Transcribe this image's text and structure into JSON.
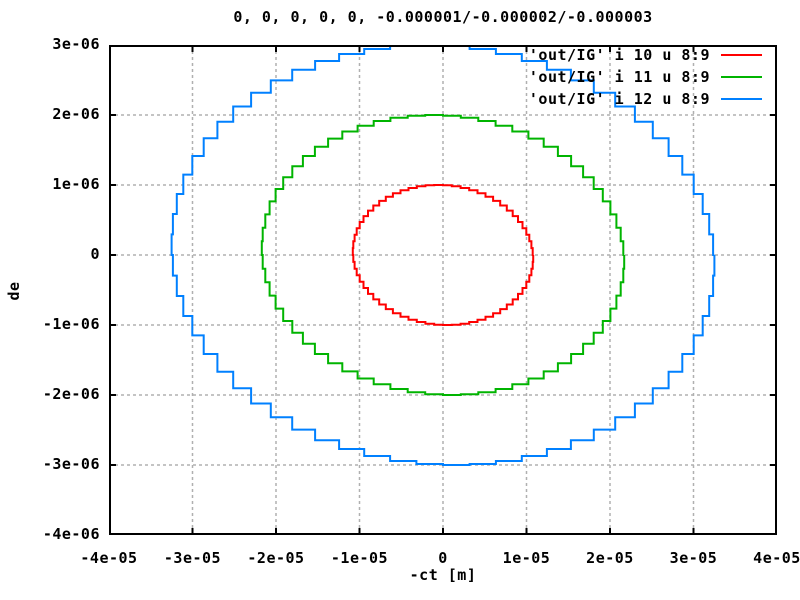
{
  "title": "0, 0, 0, 0, 0, -0.000001/-0.000002/-0.000003",
  "colors": {
    "background": "#ffffff",
    "border": "#000000",
    "grid": "#b0b0b0",
    "red": "#ff0000",
    "green": "#00b400",
    "blue": "#0080ff"
  },
  "chart_data": {
    "type": "line",
    "style": "steps",
    "title": "0, 0, 0, 0, 0, -0.000001/-0.000002/-0.000003",
    "xlabel": "-ct [m]",
    "ylabel": "de",
    "xlim": [
      -4e-05,
      4e-05
    ],
    "ylim": [
      -4e-06,
      3e-06
    ],
    "xticks": [
      -4e-05,
      -3e-05,
      -2e-05,
      -1e-05,
      0,
      1e-05,
      2e-05,
      3e-05,
      4e-05
    ],
    "xtick_labels": [
      "-4e-05",
      "-3e-05",
      "-2e-05",
      "-1e-05",
      "0",
      "1e-05",
      "2e-05",
      "3e-05",
      "4e-05"
    ],
    "yticks": [
      -4e-06,
      -3e-06,
      -2e-06,
      -1e-06,
      0,
      1e-06,
      2e-06,
      3e-06
    ],
    "ytick_labels": [
      "-4e-06",
      "-3e-06",
      "-2e-06",
      "-1e-06",
      "0",
      "1e-06",
      "2e-06",
      "3e-06"
    ],
    "grid": true,
    "grid_dash": "3,3",
    "legend_position": "top-right-inside",
    "points_per_ellipse": 64,
    "series": [
      {
        "name": "'out/IG' i 10 u 8:9",
        "color": "#ff0000",
        "shape": "stepped-ellipse",
        "center_x": 0,
        "center_y": 0,
        "x_semi_axis": 1.08e-05,
        "y_semi_axis": 1e-06
      },
      {
        "name": "'out/IG' i 11 u 8:9",
        "color": "#00b400",
        "shape": "stepped-ellipse",
        "center_x": 0,
        "center_y": 0,
        "x_semi_axis": 2.17e-05,
        "y_semi_axis": 2e-06
      },
      {
        "name": "'out/IG' i 12 u 8:9",
        "color": "#0080ff",
        "shape": "stepped-ellipse",
        "center_x": 0,
        "center_y": 0,
        "x_semi_axis": 3.25e-05,
        "y_semi_axis": 3e-06
      }
    ]
  }
}
